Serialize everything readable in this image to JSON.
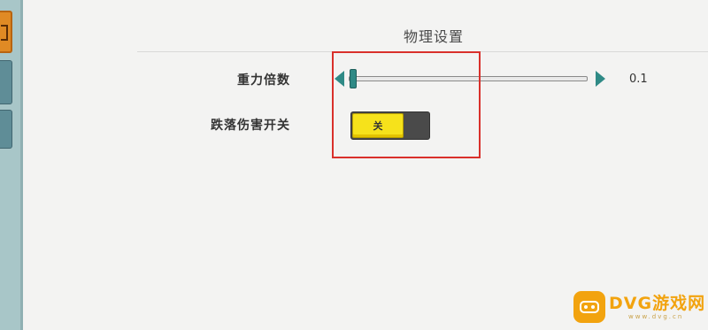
{
  "section": {
    "title": "物理设置"
  },
  "gravity": {
    "label": "重力倍数",
    "value_text": "0.1",
    "value": 0.1
  },
  "fall_damage": {
    "label": "跌落伤害开关",
    "toggle_text": "关",
    "state": "off"
  },
  "watermark": {
    "brand": "DVG游戏网",
    "url": "www.dvg.cn"
  },
  "colors": {
    "accent_teal": "#2f8a86",
    "toggle_on_yellow": "#f6e21b",
    "highlight_red": "#d9302b",
    "watermark_orange": "#f2a30f",
    "rail_active_orange": "#e08a24"
  }
}
